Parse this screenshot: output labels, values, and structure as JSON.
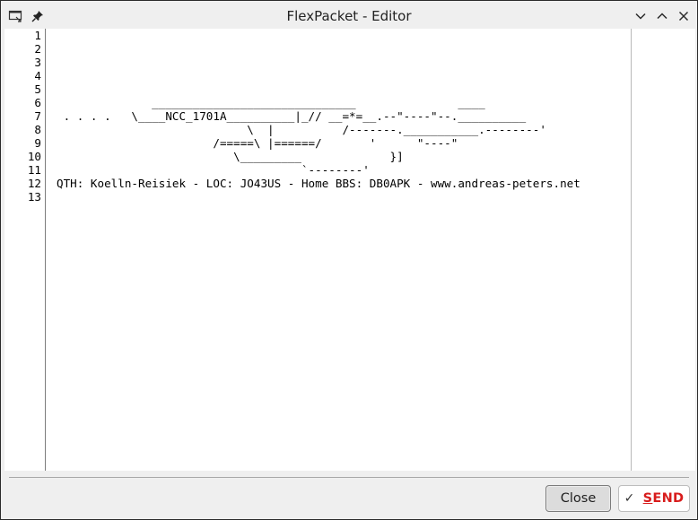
{
  "window": {
    "title": "FlexPacket - Editor",
    "icons": [
      "window-menu-icon",
      "pin-icon",
      "minimize-icon",
      "maximize-icon",
      "close-icon"
    ]
  },
  "editor": {
    "line_numbers": [
      "1",
      "2",
      "3",
      "4",
      "5",
      "6",
      "7",
      "8",
      "9",
      "10",
      "11",
      "12",
      "13"
    ],
    "content": "\n\n\n\n\n              ______________________________               ____\n . . . .   \\____NCC_1701A__________|_// __=*=__.--\"----\"--.__________\n                            \\  |          /-------.___________.--------'\n                       /=====\\ |======/       '      \"----\"\n                          \\_________             }]\n                                    `--------'\nQTH: Koelln-Reisiek - LOC: JO43US - Home BBS: DB0APK - www.andreas-peters.net\n"
  },
  "buttons": {
    "close_label": "Close",
    "send_label": "SEND",
    "send_accent": "#d81c1c"
  }
}
